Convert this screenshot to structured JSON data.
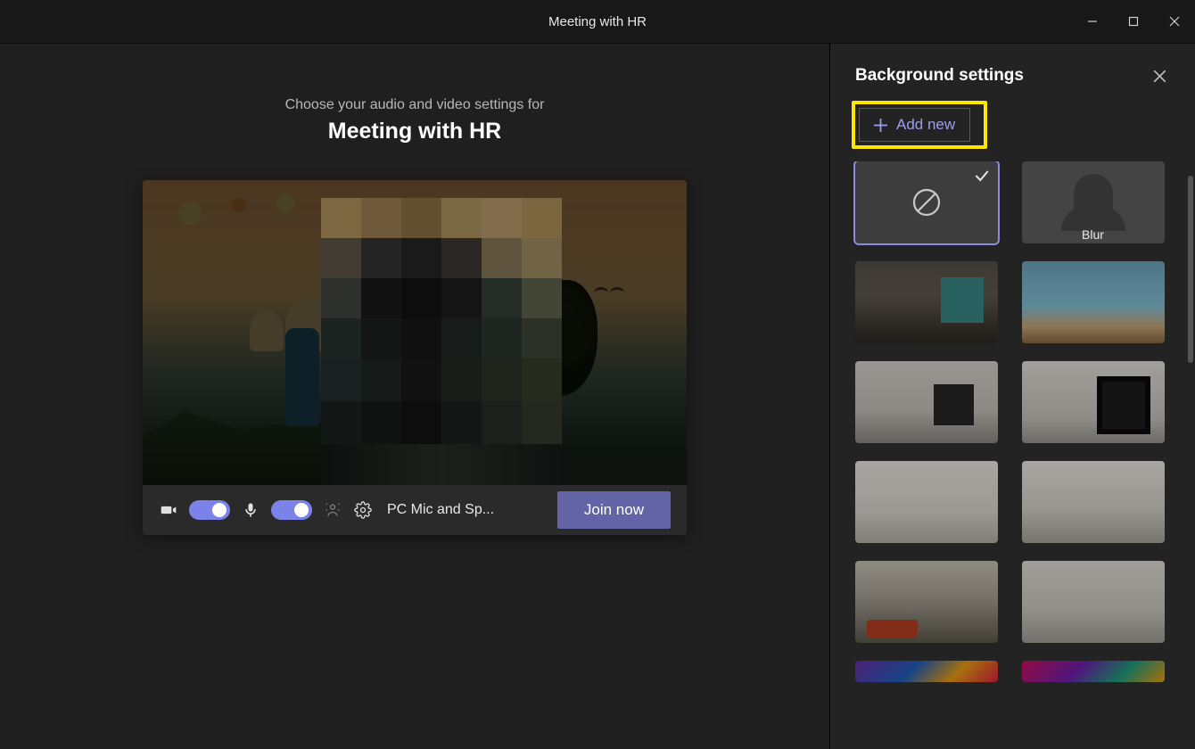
{
  "window": {
    "title": "Meeting with HR"
  },
  "prejoin": {
    "subtitle": "Choose your audio and video settings for",
    "meeting_title": "Meeting with HR",
    "audio_device": "PC Mic and Sp...",
    "join_label": "Join now"
  },
  "panel": {
    "title": "Background settings",
    "add_new_label": "Add new",
    "options": {
      "none": {
        "selected": true
      },
      "blur": {
        "label": "Blur"
      }
    }
  },
  "colors": {
    "accent": "#6264a7",
    "toggle_on": "#7b83eb",
    "highlight": "#ffe600"
  }
}
